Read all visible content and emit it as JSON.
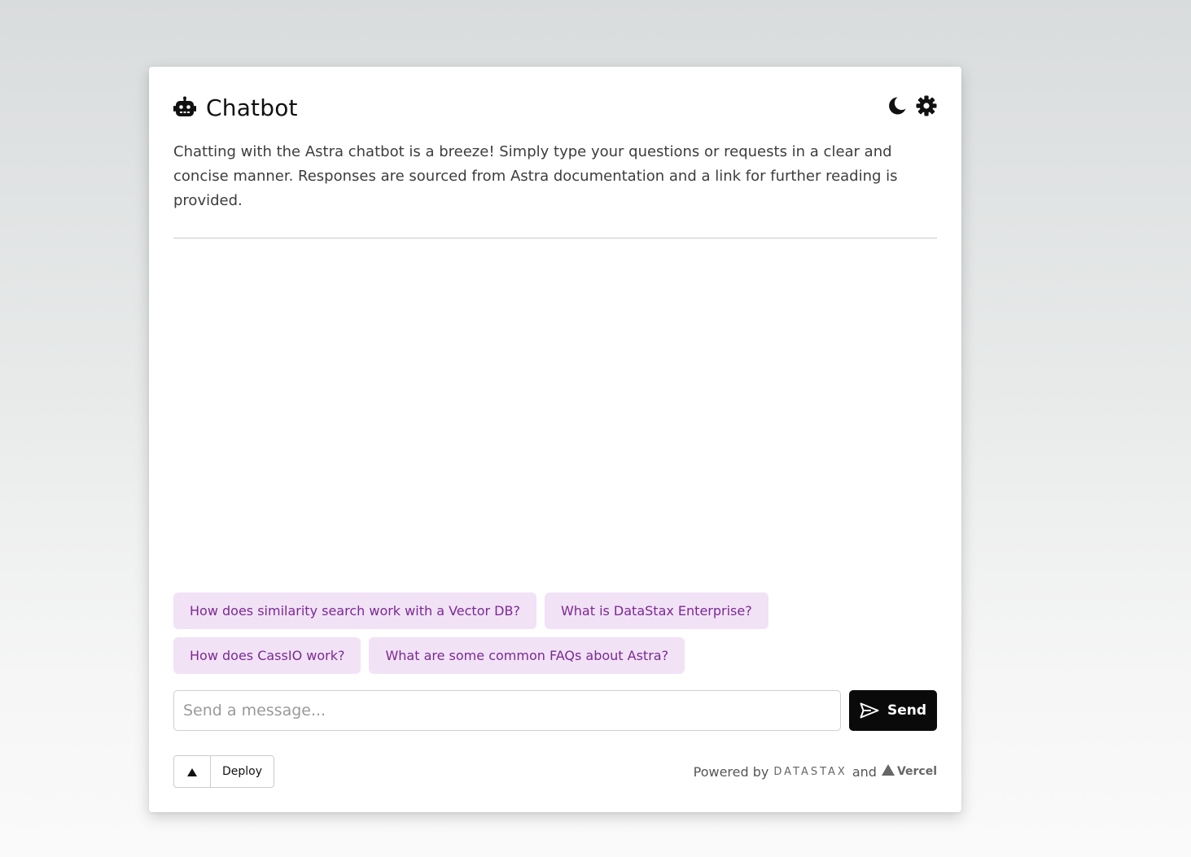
{
  "header": {
    "title": "Chatbot",
    "icons": {
      "logo": "robot-icon",
      "theme": "moon-icon",
      "settings": "gear-icon"
    }
  },
  "description": "Chatting with the Astra chatbot is a breeze! Simply type your questions or requests in a clear and concise manner. Responses are sourced from Astra documentation and a link for further reading is provided.",
  "suggestions": [
    "How does similarity search work with a Vector DB?",
    "What is DataStax Enterprise?",
    "How does CassIO work?",
    "What are some common FAQs about Astra?"
  ],
  "composer": {
    "placeholder": "Send a message...",
    "value": "",
    "send_label": "Send"
  },
  "footer": {
    "deploy_label": "Deploy",
    "powered_by": "Powered by",
    "datastax": "DATASTAX",
    "and": "and",
    "vercel": "Vercel"
  },
  "colors": {
    "chip_bg": "#f2e2f6",
    "chip_text": "#7a2a93",
    "send_bg": "#0a0a0a"
  }
}
